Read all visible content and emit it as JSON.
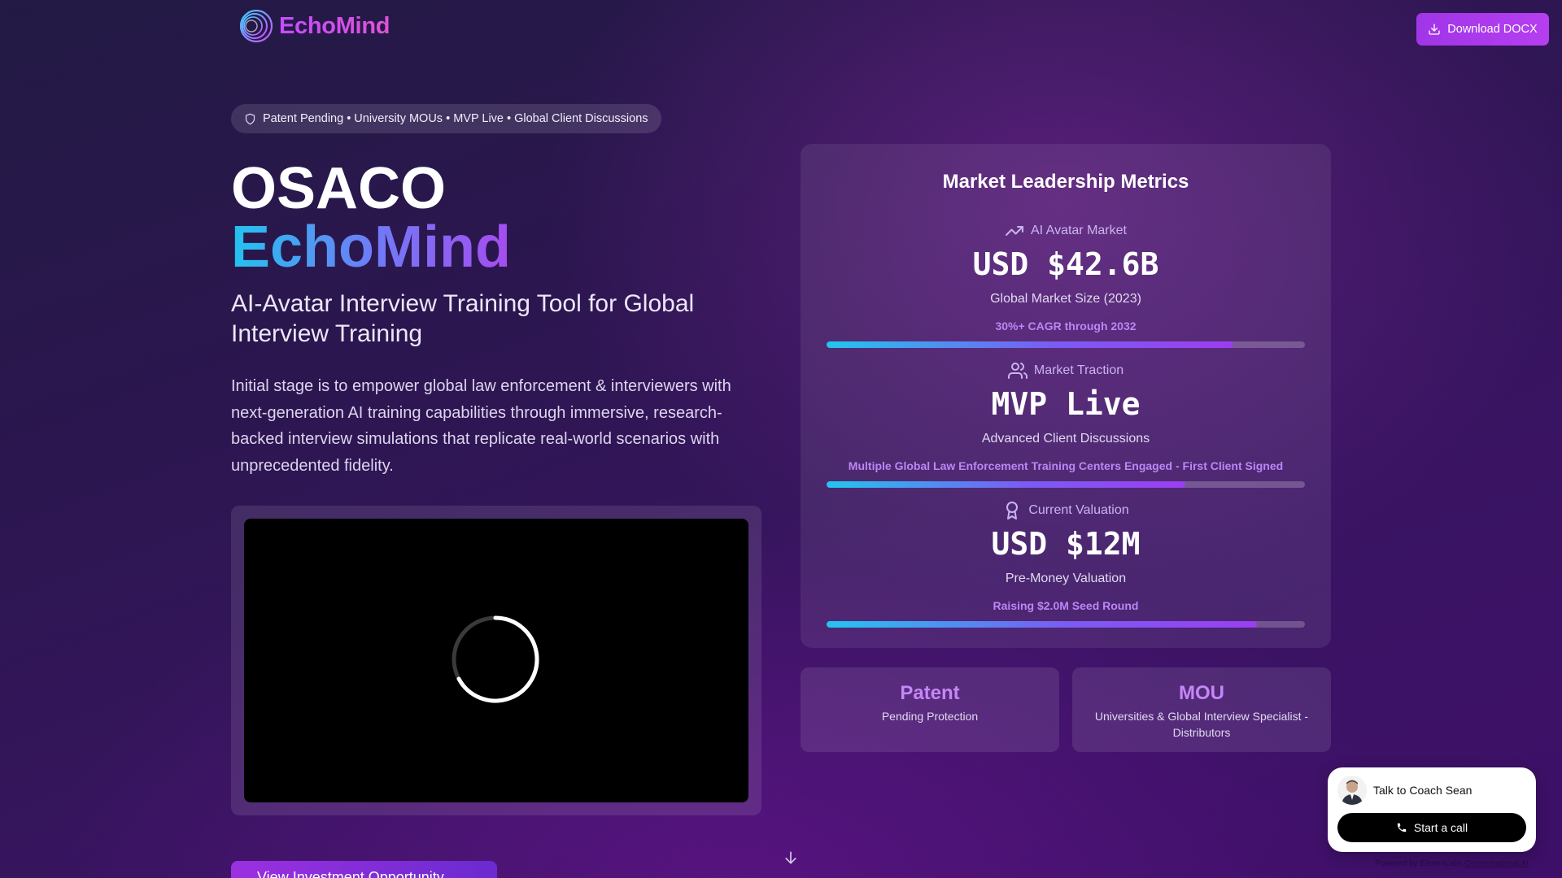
{
  "header": {
    "brand": "EchoMind",
    "download_label": "Download DOCX"
  },
  "pill": {
    "text": "Patent Pending • University MOUs • MVP Live • Global Client Discussions"
  },
  "hero": {
    "title_line1": "OSACO",
    "title_line2": "EchoMind",
    "subtitle": "AI-Avatar Interview Training Tool  for Global Interview Training",
    "description": "Initial stage is to empower global law enforcement  & interviewers with next-generation AI training capabilities through immersive, research-backed interview simulations that replicate real-world scenarios with unprecedented fidelity."
  },
  "cta": {
    "label": "View Investment Opportunity",
    "arrow": "→"
  },
  "metrics": {
    "title": "Market Leadership Metrics",
    "items": [
      {
        "icon": "trending-up-icon",
        "label": "AI Avatar Market",
        "value": "USD $42.6B",
        "caption": "Global Market Size (2023)",
        "note": "30%+ CAGR through 2032",
        "progress": 0.85
      },
      {
        "icon": "users-icon",
        "label": "Market Traction",
        "value": "MVP Live",
        "caption": "Advanced Client Discussions",
        "note": "Multiple Global Law Enforcement Training Centers Engaged - First Client Signed",
        "progress": 0.75
      },
      {
        "icon": "award-icon",
        "label": "Current Valuation",
        "value": "USD $12M",
        "caption": "Pre-Money Valuation",
        "note": "Raising $2.0M Seed Round",
        "progress": 0.9
      }
    ]
  },
  "cards": [
    {
      "title": "Patent",
      "subtitle": "Pending Protection"
    },
    {
      "title": "MOU",
      "subtitle": "Universities & Global Interview Specialist - Distributors"
    }
  ],
  "coach": {
    "name": "Talk to Coach Sean",
    "call_label": "Start a call",
    "powered_prefix": "Powered by ElevenLabs",
    "powered_link": "Conversational AI"
  },
  "colors": {
    "accent": "#a035e8",
    "gradient_start": "#22c6ef",
    "gradient_end": "#a64cf0",
    "note_color": "#bc86f5"
  }
}
